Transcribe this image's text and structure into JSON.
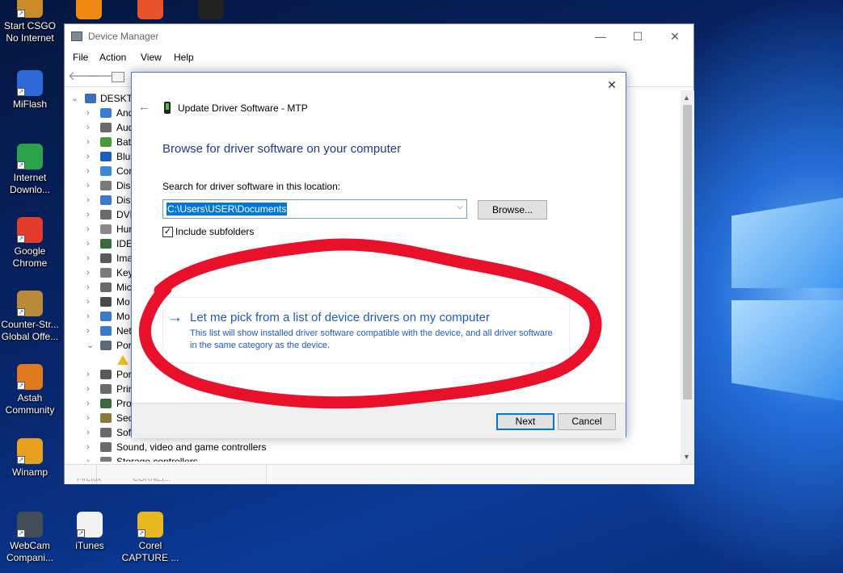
{
  "desktop": {
    "icons": [
      {
        "label": "Start CSGO No Internet",
        "icon": "csgo-icon",
        "color": "#c98a2a"
      },
      {
        "label": "MiFlash",
        "icon": "miflash-shield-icon",
        "color": "#2f68d8"
      },
      {
        "label": "Internet Downlo...",
        "icon": "internet-download-manager-icon",
        "color": "#2aa34a"
      },
      {
        "label": "Google Chrome",
        "icon": "chrome-icon",
        "color": "#e33b2e"
      },
      {
        "label": "Counter-Str... Global Offe...",
        "icon": "counter-strike-icon",
        "color": "#b88a3a"
      },
      {
        "label": "Astah Community",
        "icon": "astah-icon",
        "color": "#e07a1f"
      },
      {
        "label": "Winamp",
        "icon": "winamp-icon",
        "color": "#e8a020"
      },
      {
        "label": "WebCam Compani...",
        "icon": "webcam-icon",
        "color": "#444c58"
      },
      {
        "label": "iTunes",
        "icon": "itunes-icon",
        "color": "#f2f2f2"
      },
      {
        "label": "Corel CAPTURE ...",
        "icon": "corel-capture-icon",
        "color": "#e8b820"
      }
    ],
    "top_icons": [
      {
        "icon": "vlc-icon",
        "color": "#f08a12"
      },
      {
        "icon": "camera-app-icon",
        "color": "#e8532a"
      },
      {
        "icon": "blackberry-icon",
        "color": "#222222"
      }
    ]
  },
  "device_manager": {
    "title": "Device Manager",
    "menu": [
      "File",
      "Action",
      "View",
      "Help"
    ],
    "root": "DESKTO",
    "tree": [
      {
        "label": "And",
        "chevron": "›",
        "color": "#3c7ad8"
      },
      {
        "label": "Aud",
        "chevron": "›",
        "color": "#6a6a6a"
      },
      {
        "label": "Bat",
        "chevron": "›",
        "color": "#4a9a3a"
      },
      {
        "label": "Blu",
        "chevron": "›",
        "color": "#1a5fc0"
      },
      {
        "label": "Cor",
        "chevron": "›",
        "color": "#3a8ad8"
      },
      {
        "label": "Disl",
        "chevron": "›",
        "color": "#7a7a7a"
      },
      {
        "label": "Disp",
        "chevron": "›",
        "color": "#3a7ac8"
      },
      {
        "label": "DVD",
        "chevron": "›",
        "color": "#6a6a6a"
      },
      {
        "label": "Hur",
        "chevron": "›",
        "color": "#8a8a8a"
      },
      {
        "label": "IDE",
        "chevron": "›",
        "color": "#3a6a3a"
      },
      {
        "label": "Ima",
        "chevron": "›",
        "color": "#5a5a5a"
      },
      {
        "label": "Key",
        "chevron": "›",
        "color": "#7a7a7a"
      },
      {
        "label": "Mic",
        "chevron": "›",
        "color": "#6a6a6a"
      },
      {
        "label": "Mo",
        "chevron": "›",
        "color": "#4a4a4a"
      },
      {
        "label": "Mo",
        "chevron": "›",
        "color": "#3a7ac8"
      },
      {
        "label": "Net",
        "chevron": "›",
        "color": "#3a7ac8"
      },
      {
        "label": "Por",
        "chevron": "⌄",
        "color": "#5a6a7a"
      },
      {
        "label": "",
        "chevron": "",
        "color": "#f0c020"
      },
      {
        "label": "Por",
        "chevron": "›",
        "color": "#5a5a5a"
      },
      {
        "label": "Prir",
        "chevron": "›",
        "color": "#6a6a6a"
      },
      {
        "label": "Pro",
        "chevron": "›",
        "color": "#3a6a3a"
      },
      {
        "label": "Sec",
        "chevron": "›",
        "color": "#8a7a3a"
      },
      {
        "label": "Sof",
        "chevron": "›",
        "color": "#6a6a6a"
      },
      {
        "label": "Sound, video and game controllers",
        "chevron": "›",
        "color": "#6a6a6a"
      },
      {
        "label": "Storage controllers",
        "chevron": "›",
        "color": "#7a7a7a"
      }
    ],
    "bottom_fragments": [
      "Firefox",
      "CORNEI..."
    ]
  },
  "dialog": {
    "title": "Update Driver Software - MTP",
    "heading": "Browse for driver software on your computer",
    "search_label": "Search for driver software in this location:",
    "path_value": "C:\\Users\\USER\\Documents",
    "browse_label": "Browse...",
    "include_subfolders_label": "Include subfolders",
    "include_subfolders_checked": true,
    "pick_title": "Let me pick from a list of device drivers on my computer",
    "pick_description": "This list will show installed driver software compatible with the device, and all driver software in the same category as the device.",
    "next_label": "Next",
    "cancel_label": "Cancel"
  },
  "colors": {
    "accent_blue": "#1d5ac2",
    "heading_blue": "#1d3a8f",
    "annotation_red": "#e8102a"
  }
}
